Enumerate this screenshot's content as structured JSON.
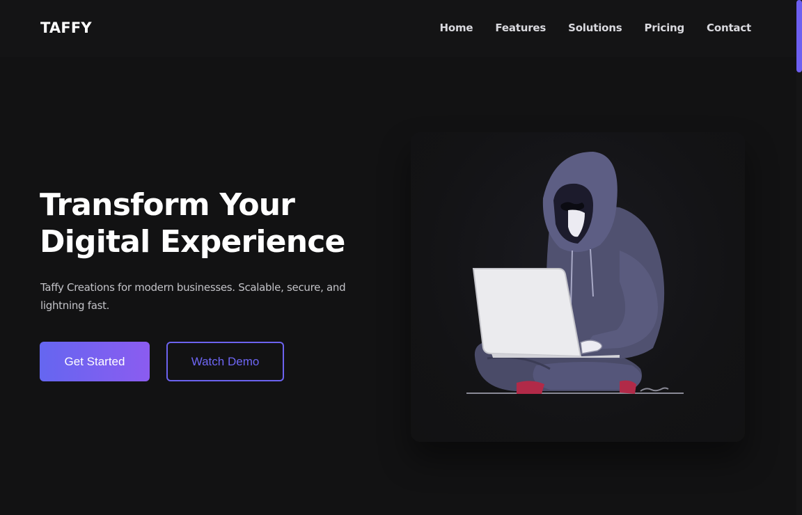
{
  "header": {
    "logo": "TAFFY",
    "nav": [
      {
        "label": "Home"
      },
      {
        "label": "Features"
      },
      {
        "label": "Solutions"
      },
      {
        "label": "Pricing"
      },
      {
        "label": "Contact"
      }
    ]
  },
  "hero": {
    "title_line1": "Transform Your",
    "title_line2": "Digital Experience",
    "subtitle": "Taffy Creations for modern businesses. Scalable, secure, and lightning fast.",
    "primary_button": "Get Started",
    "secondary_button": "Watch Demo",
    "illustration": "hooded-hacker-with-laptop"
  },
  "colors": {
    "background": "#121213",
    "accent": "#6c63f0",
    "accent_gradient_end": "#8b5cf0",
    "text_muted": "#c3c3c8"
  }
}
